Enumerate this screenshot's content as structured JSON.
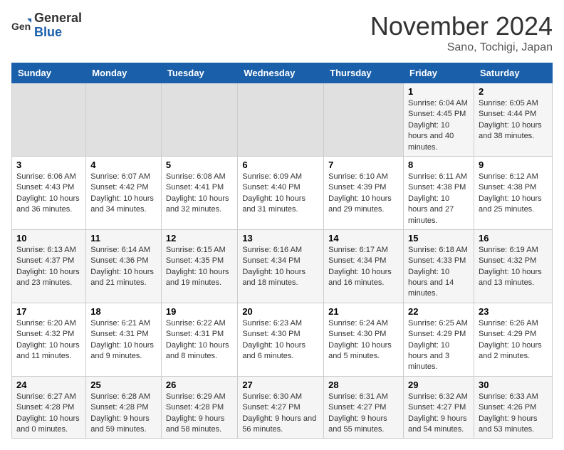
{
  "header": {
    "logo_general": "General",
    "logo_blue": "Blue",
    "month_title": "November 2024",
    "location": "Sano, Tochigi, Japan"
  },
  "weekdays": [
    "Sunday",
    "Monday",
    "Tuesday",
    "Wednesday",
    "Thursday",
    "Friday",
    "Saturday"
  ],
  "weeks": [
    [
      {
        "day": "",
        "info": ""
      },
      {
        "day": "",
        "info": ""
      },
      {
        "day": "",
        "info": ""
      },
      {
        "day": "",
        "info": ""
      },
      {
        "day": "",
        "info": ""
      },
      {
        "day": "1",
        "info": "Sunrise: 6:04 AM\nSunset: 4:45 PM\nDaylight: 10 hours and 40 minutes."
      },
      {
        "day": "2",
        "info": "Sunrise: 6:05 AM\nSunset: 4:44 PM\nDaylight: 10 hours and 38 minutes."
      }
    ],
    [
      {
        "day": "3",
        "info": "Sunrise: 6:06 AM\nSunset: 4:43 PM\nDaylight: 10 hours and 36 minutes."
      },
      {
        "day": "4",
        "info": "Sunrise: 6:07 AM\nSunset: 4:42 PM\nDaylight: 10 hours and 34 minutes."
      },
      {
        "day": "5",
        "info": "Sunrise: 6:08 AM\nSunset: 4:41 PM\nDaylight: 10 hours and 32 minutes."
      },
      {
        "day": "6",
        "info": "Sunrise: 6:09 AM\nSunset: 4:40 PM\nDaylight: 10 hours and 31 minutes."
      },
      {
        "day": "7",
        "info": "Sunrise: 6:10 AM\nSunset: 4:39 PM\nDaylight: 10 hours and 29 minutes."
      },
      {
        "day": "8",
        "info": "Sunrise: 6:11 AM\nSunset: 4:38 PM\nDaylight: 10 hours and 27 minutes."
      },
      {
        "day": "9",
        "info": "Sunrise: 6:12 AM\nSunset: 4:38 PM\nDaylight: 10 hours and 25 minutes."
      }
    ],
    [
      {
        "day": "10",
        "info": "Sunrise: 6:13 AM\nSunset: 4:37 PM\nDaylight: 10 hours and 23 minutes."
      },
      {
        "day": "11",
        "info": "Sunrise: 6:14 AM\nSunset: 4:36 PM\nDaylight: 10 hours and 21 minutes."
      },
      {
        "day": "12",
        "info": "Sunrise: 6:15 AM\nSunset: 4:35 PM\nDaylight: 10 hours and 19 minutes."
      },
      {
        "day": "13",
        "info": "Sunrise: 6:16 AM\nSunset: 4:34 PM\nDaylight: 10 hours and 18 minutes."
      },
      {
        "day": "14",
        "info": "Sunrise: 6:17 AM\nSunset: 4:34 PM\nDaylight: 10 hours and 16 minutes."
      },
      {
        "day": "15",
        "info": "Sunrise: 6:18 AM\nSunset: 4:33 PM\nDaylight: 10 hours and 14 minutes."
      },
      {
        "day": "16",
        "info": "Sunrise: 6:19 AM\nSunset: 4:32 PM\nDaylight: 10 hours and 13 minutes."
      }
    ],
    [
      {
        "day": "17",
        "info": "Sunrise: 6:20 AM\nSunset: 4:32 PM\nDaylight: 10 hours and 11 minutes."
      },
      {
        "day": "18",
        "info": "Sunrise: 6:21 AM\nSunset: 4:31 PM\nDaylight: 10 hours and 9 minutes."
      },
      {
        "day": "19",
        "info": "Sunrise: 6:22 AM\nSunset: 4:31 PM\nDaylight: 10 hours and 8 minutes."
      },
      {
        "day": "20",
        "info": "Sunrise: 6:23 AM\nSunset: 4:30 PM\nDaylight: 10 hours and 6 minutes."
      },
      {
        "day": "21",
        "info": "Sunrise: 6:24 AM\nSunset: 4:30 PM\nDaylight: 10 hours and 5 minutes."
      },
      {
        "day": "22",
        "info": "Sunrise: 6:25 AM\nSunset: 4:29 PM\nDaylight: 10 hours and 3 minutes."
      },
      {
        "day": "23",
        "info": "Sunrise: 6:26 AM\nSunset: 4:29 PM\nDaylight: 10 hours and 2 minutes."
      }
    ],
    [
      {
        "day": "24",
        "info": "Sunrise: 6:27 AM\nSunset: 4:28 PM\nDaylight: 10 hours and 0 minutes."
      },
      {
        "day": "25",
        "info": "Sunrise: 6:28 AM\nSunset: 4:28 PM\nDaylight: 9 hours and 59 minutes."
      },
      {
        "day": "26",
        "info": "Sunrise: 6:29 AM\nSunset: 4:28 PM\nDaylight: 9 hours and 58 minutes."
      },
      {
        "day": "27",
        "info": "Sunrise: 6:30 AM\nSunset: 4:27 PM\nDaylight: 9 hours and 56 minutes."
      },
      {
        "day": "28",
        "info": "Sunrise: 6:31 AM\nSunset: 4:27 PM\nDaylight: 9 hours and 55 minutes."
      },
      {
        "day": "29",
        "info": "Sunrise: 6:32 AM\nSunset: 4:27 PM\nDaylight: 9 hours and 54 minutes."
      },
      {
        "day": "30",
        "info": "Sunrise: 6:33 AM\nSunset: 4:26 PM\nDaylight: 9 hours and 53 minutes."
      }
    ]
  ]
}
